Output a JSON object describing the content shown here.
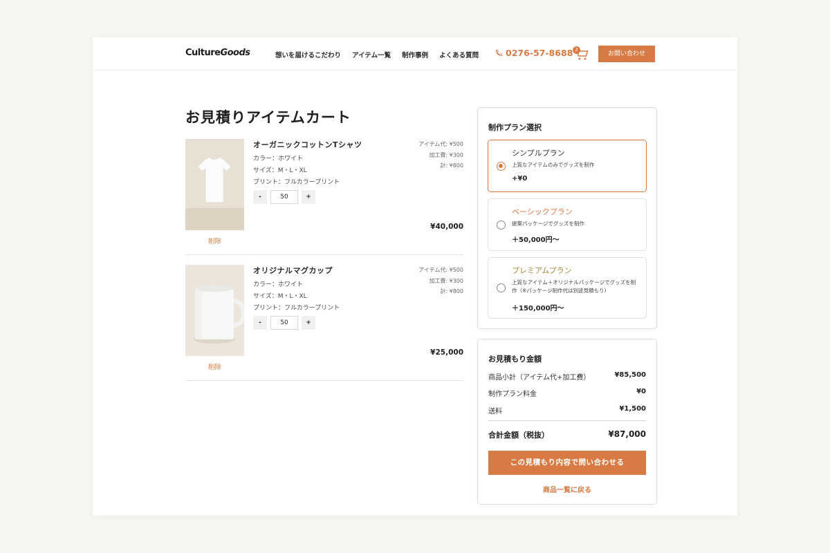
{
  "header": {
    "logo_plain": "Culture",
    "logo_italic": "Goods",
    "nav": [
      "想いを届けるこだわり",
      "アイテム一覧",
      "制作事例",
      "よくある質問"
    ],
    "phone": "0276-57-8688",
    "cart_count": "2",
    "contact_label": "お問い合わせ"
  },
  "cart": {
    "title": "お見積りアイテムカート",
    "delete_label": "削除",
    "items": [
      {
        "name": "オーガニックコットンTシャツ",
        "color": "カラー：ホワイト",
        "size": "サイズ：M・L・XL",
        "print": "プリント：フルカラープリント",
        "quantity": "50",
        "item_price": "アイテム代: ¥500",
        "process_price": "加工費: ¥300",
        "unit_total": "計: ¥800",
        "total": "¥40,000"
      },
      {
        "name": "オリジナルマグカップ",
        "color": "カラー：ホワイト",
        "size": "サイズ：M・L・XL",
        "print": "プリント：フルカラープリント",
        "quantity": "50",
        "item_price": "アイテム代: ¥500",
        "process_price": "加工費: ¥300",
        "unit_total": "計: ¥800",
        "total": "¥25,000"
      }
    ],
    "minus_label": "-",
    "plus_label": "+"
  },
  "plans": {
    "title": "制作プラン選択",
    "options": [
      {
        "name": "シンプルプラン",
        "desc": "上質なアイテムのみでグッズを制作",
        "price": "+¥0",
        "selected": true,
        "name_color": "#333333"
      },
      {
        "name": "ベーシックプラン",
        "desc": "提案パッケージでグッズを制作",
        "price": "＋50,000円〜",
        "selected": false,
        "name_color": "#d97a44"
      },
      {
        "name": "プレミアムプラン",
        "desc": "上質なアイテム＋オリジナルパッケージでグッズを制作（※パッケージ制作代は別途見積もり）",
        "price": "＋150,000円〜",
        "selected": false,
        "name_color": "#a98a3c"
      }
    ]
  },
  "summary": {
    "title": "お見積もり金額",
    "subtotal_label": "商品小計（アイテム代+加工費）",
    "subtotal_value": "¥85,500",
    "plan_fee_label": "制作プラン料金",
    "plan_fee_value": "¥0",
    "shipping_label": "送料",
    "shipping_value": "¥1,500",
    "grand_total_label": "合計金額（税抜）",
    "grand_total_value": "¥87,000",
    "submit_label": "この見積もり内容で問い合わせる",
    "back_label": "商品一覧に戻る"
  },
  "colors": {
    "accent": "#d97a44",
    "background": "#f8f6f0"
  }
}
